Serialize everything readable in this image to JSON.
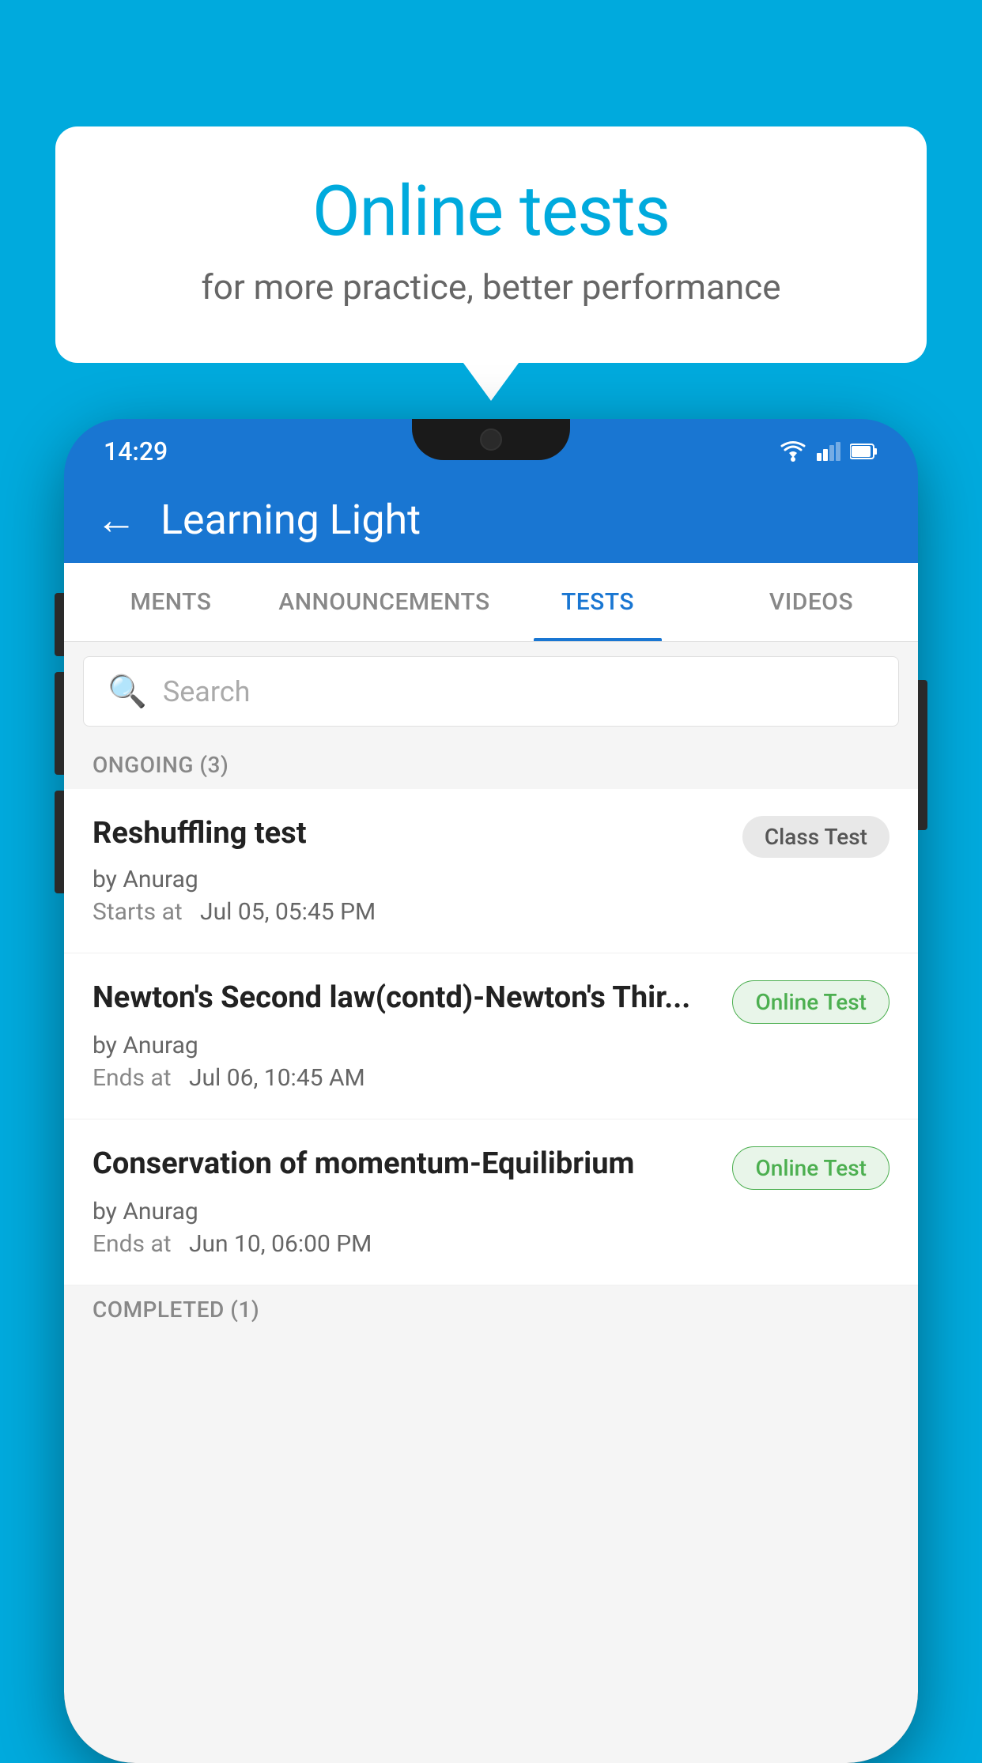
{
  "background": {
    "color": "#00AADD"
  },
  "speech_bubble": {
    "title": "Online tests",
    "subtitle": "for more practice, better performance"
  },
  "phone": {
    "status_bar": {
      "time": "14:29"
    },
    "app_header": {
      "back_label": "←",
      "title": "Learning Light"
    },
    "tabs": [
      {
        "label": "MENTS",
        "active": false
      },
      {
        "label": "ANNOUNCEMENTS",
        "active": false
      },
      {
        "label": "TESTS",
        "active": true
      },
      {
        "label": "VIDEOS",
        "active": false
      }
    ],
    "search": {
      "placeholder": "Search"
    },
    "ongoing_section": {
      "header": "ONGOING (3)",
      "tests": [
        {
          "name": "Reshuffling test",
          "badge": "Class Test",
          "badge_type": "class",
          "author": "by Anurag",
          "time_label": "Starts at",
          "time_value": "Jul 05, 05:45 PM"
        },
        {
          "name": "Newton's Second law(contd)-Newton's Thir...",
          "badge": "Online Test",
          "badge_type": "online",
          "author": "by Anurag",
          "time_label": "Ends at",
          "time_value": "Jul 06, 10:45 AM"
        },
        {
          "name": "Conservation of momentum-Equilibrium",
          "badge": "Online Test",
          "badge_type": "online",
          "author": "by Anurag",
          "time_label": "Ends at",
          "time_value": "Jun 10, 06:00 PM"
        }
      ]
    },
    "completed_section": {
      "header": "COMPLETED (1)"
    }
  }
}
